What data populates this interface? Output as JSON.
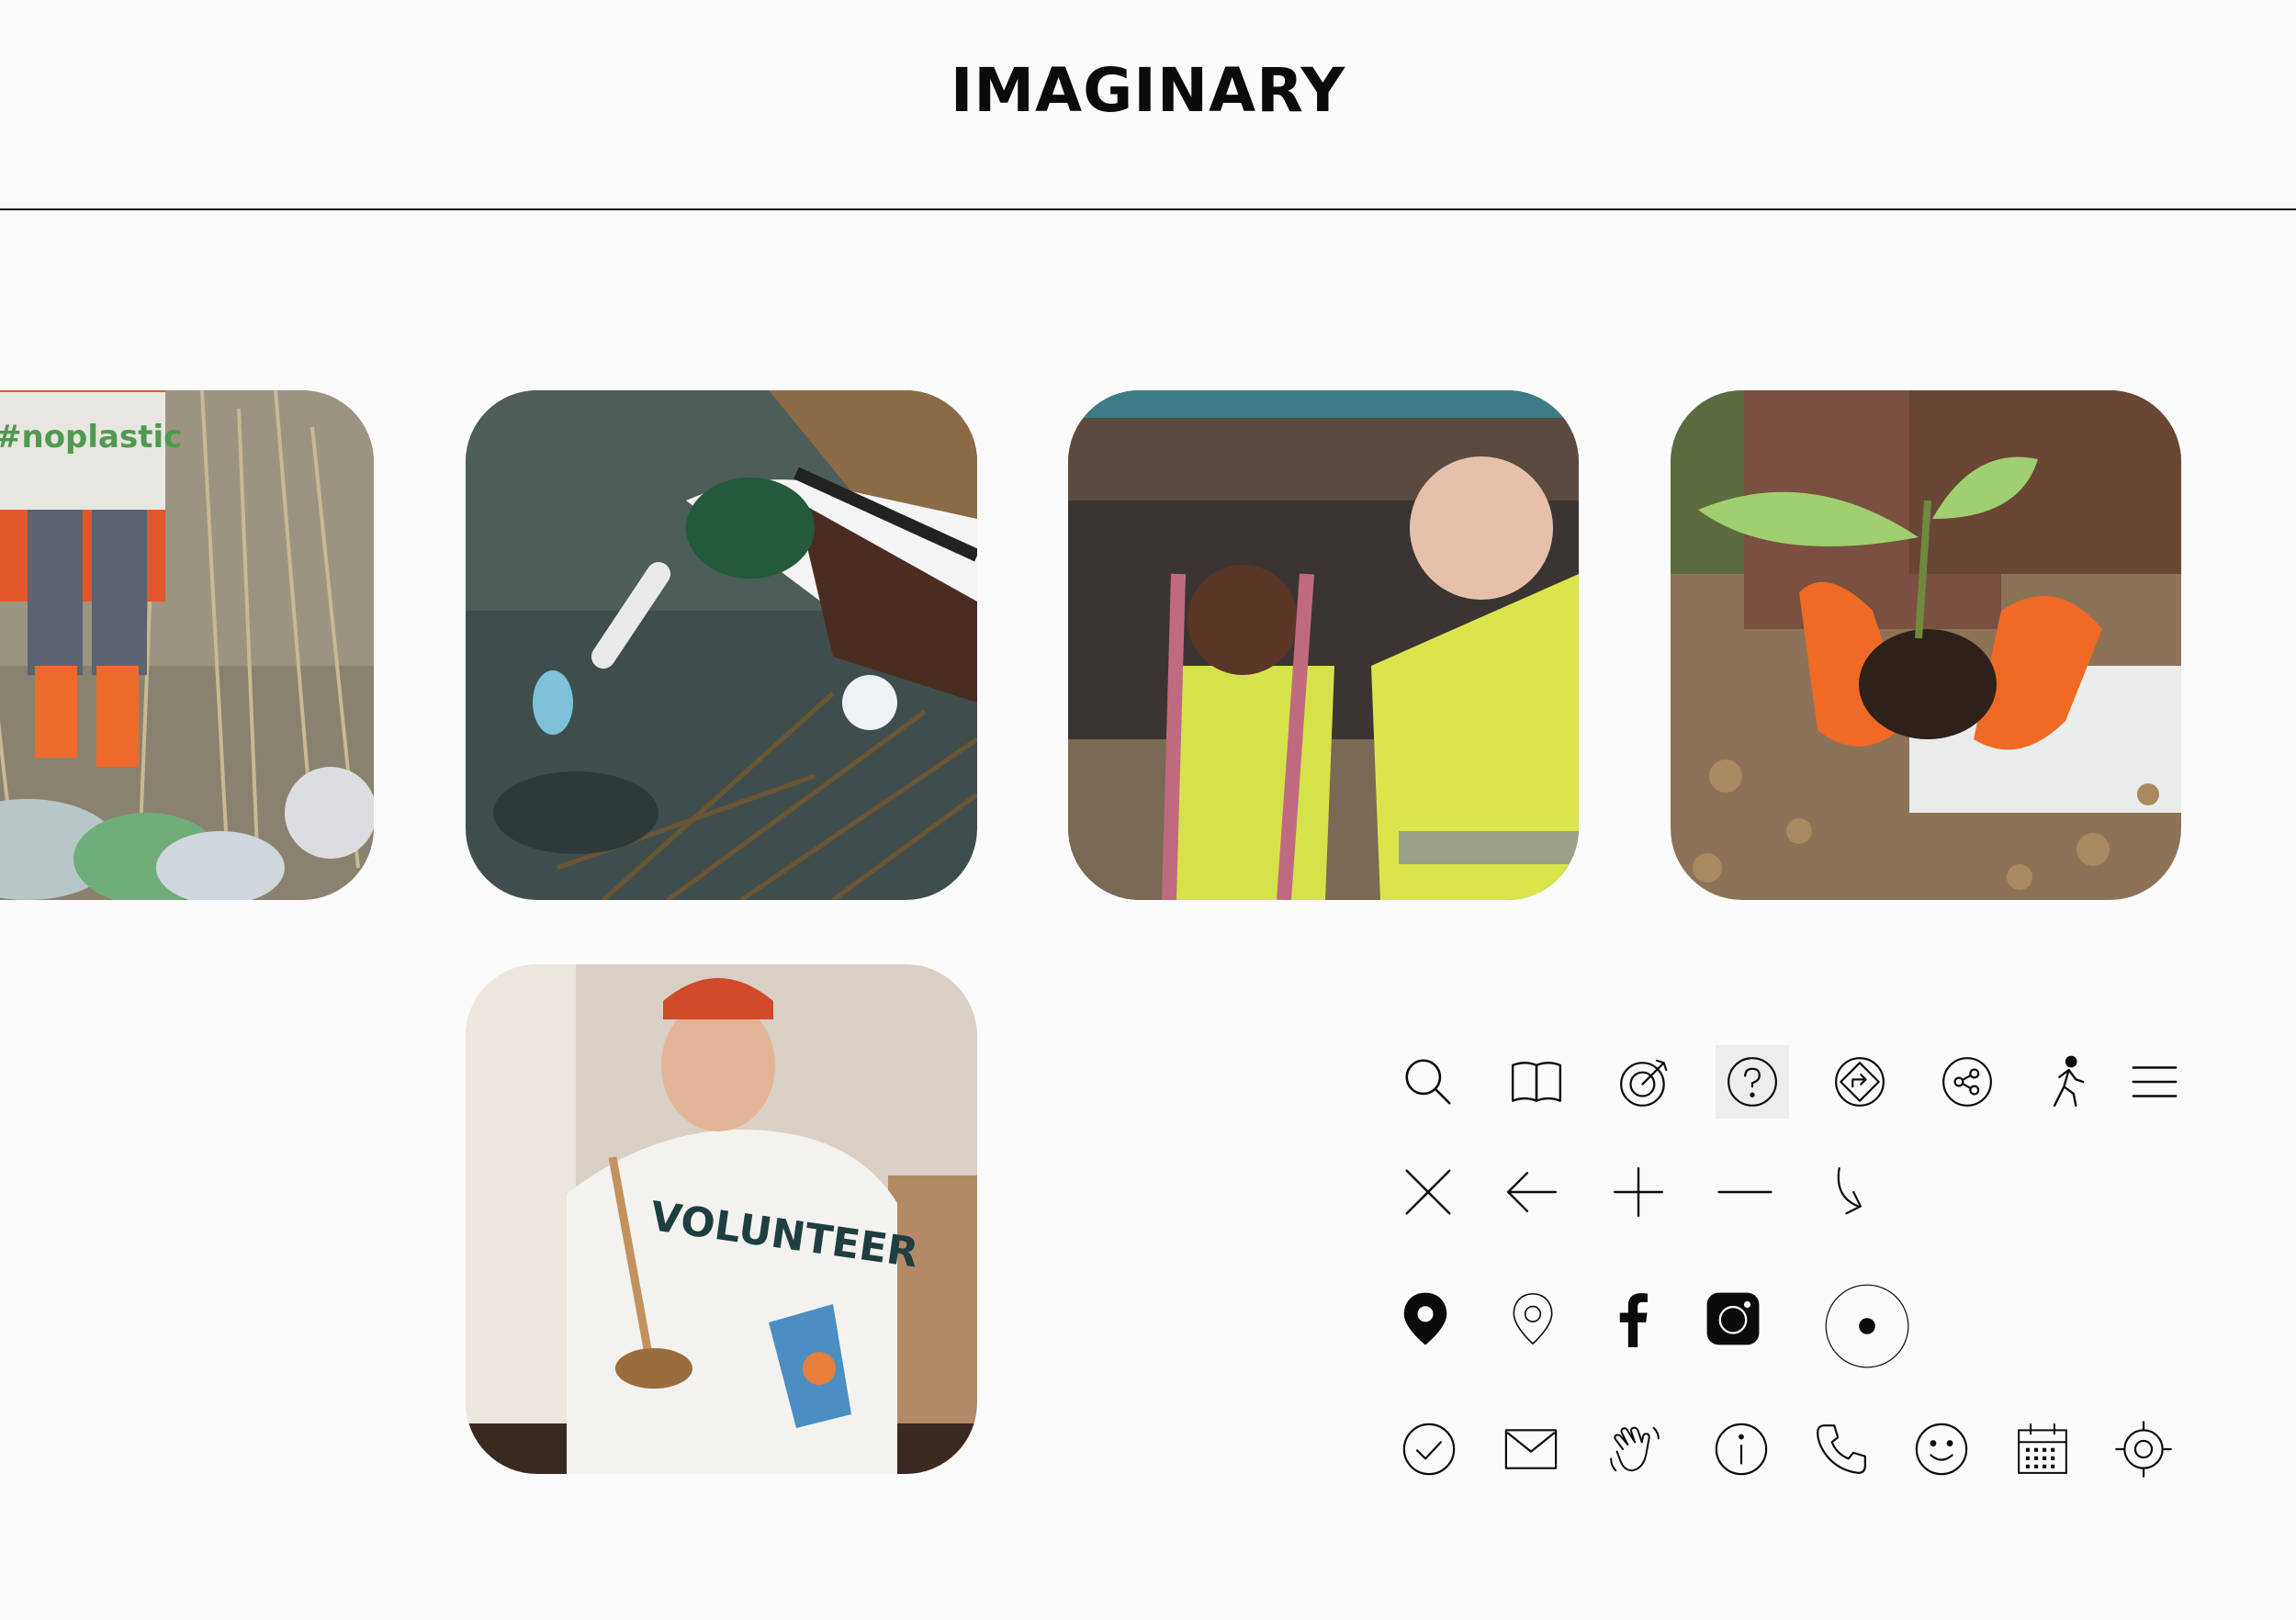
{
  "header": {
    "brand": "IMAGINARY"
  },
  "photos": [
    {
      "name": "photo-noplastic",
      "sign_text": "#noplastic"
    },
    {
      "name": "photo-river-cleanup"
    },
    {
      "name": "photo-volunteers-vests"
    },
    {
      "name": "photo-seedling"
    },
    {
      "name": "photo-volunteer-kitchen",
      "shirt_text": "VOLUNTEER"
    }
  ],
  "icons": {
    "row1": [
      "search-icon",
      "book-icon",
      "target-icon",
      "help-icon",
      "directions-icon",
      "share-icon",
      "walk-icon",
      "menu-icon"
    ],
    "row2": [
      "close-icon",
      "arrow-left-icon",
      "plus-icon",
      "minus-icon",
      "turn-arrow-icon"
    ],
    "row3": [
      "location-pin-filled-icon",
      "location-pin-outline-icon",
      "facebook-icon",
      "instagram-icon",
      "radio-dot-icon"
    ],
    "row4": [
      "check-circle-icon",
      "mail-icon",
      "wave-hand-icon",
      "info-icon",
      "phone-icon",
      "smile-icon",
      "calendar-icon",
      "crosshair-icon"
    ]
  },
  "colors": {
    "background": "#fbfbfb",
    "ink": "#0b0b0b",
    "icon_highlight": "#ededed"
  }
}
